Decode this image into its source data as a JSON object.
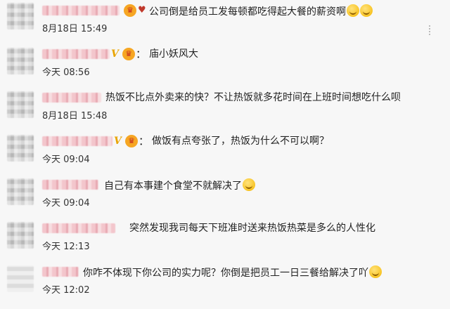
{
  "comments": [
    {
      "text": "公司倒是给员工发每顿都吃得起大餐的薪资啊",
      "time": "8月18日 15:49",
      "badge": "crown"
    },
    {
      "text": "庙小妖风大",
      "time": "今天 08:56",
      "badge": "V"
    },
    {
      "text": "热饭不比点外卖来的快？不让热饭就多花时间在上班时间想吃什么呗",
      "time": "8月18日 15:48",
      "badge": ""
    },
    {
      "text": "做饭有点夸张了，热饭为什么不可以啊？",
      "time": "今天 09:04",
      "badge": "V"
    },
    {
      "text": "自己有本事建个食堂不就解决了",
      "time": "今天 09:04",
      "badge": ""
    },
    {
      "text": "突然发现我司每天下班准时送来热饭热菜是多么的人性化",
      "time": "今天 12:13",
      "badge": ""
    },
    {
      "text": "你咋不体现下你公司的实力呢？你倒是把员工一日三餐给解决了吖",
      "time": "今天 12:02",
      "badge": ""
    }
  ],
  "colon": "："
}
